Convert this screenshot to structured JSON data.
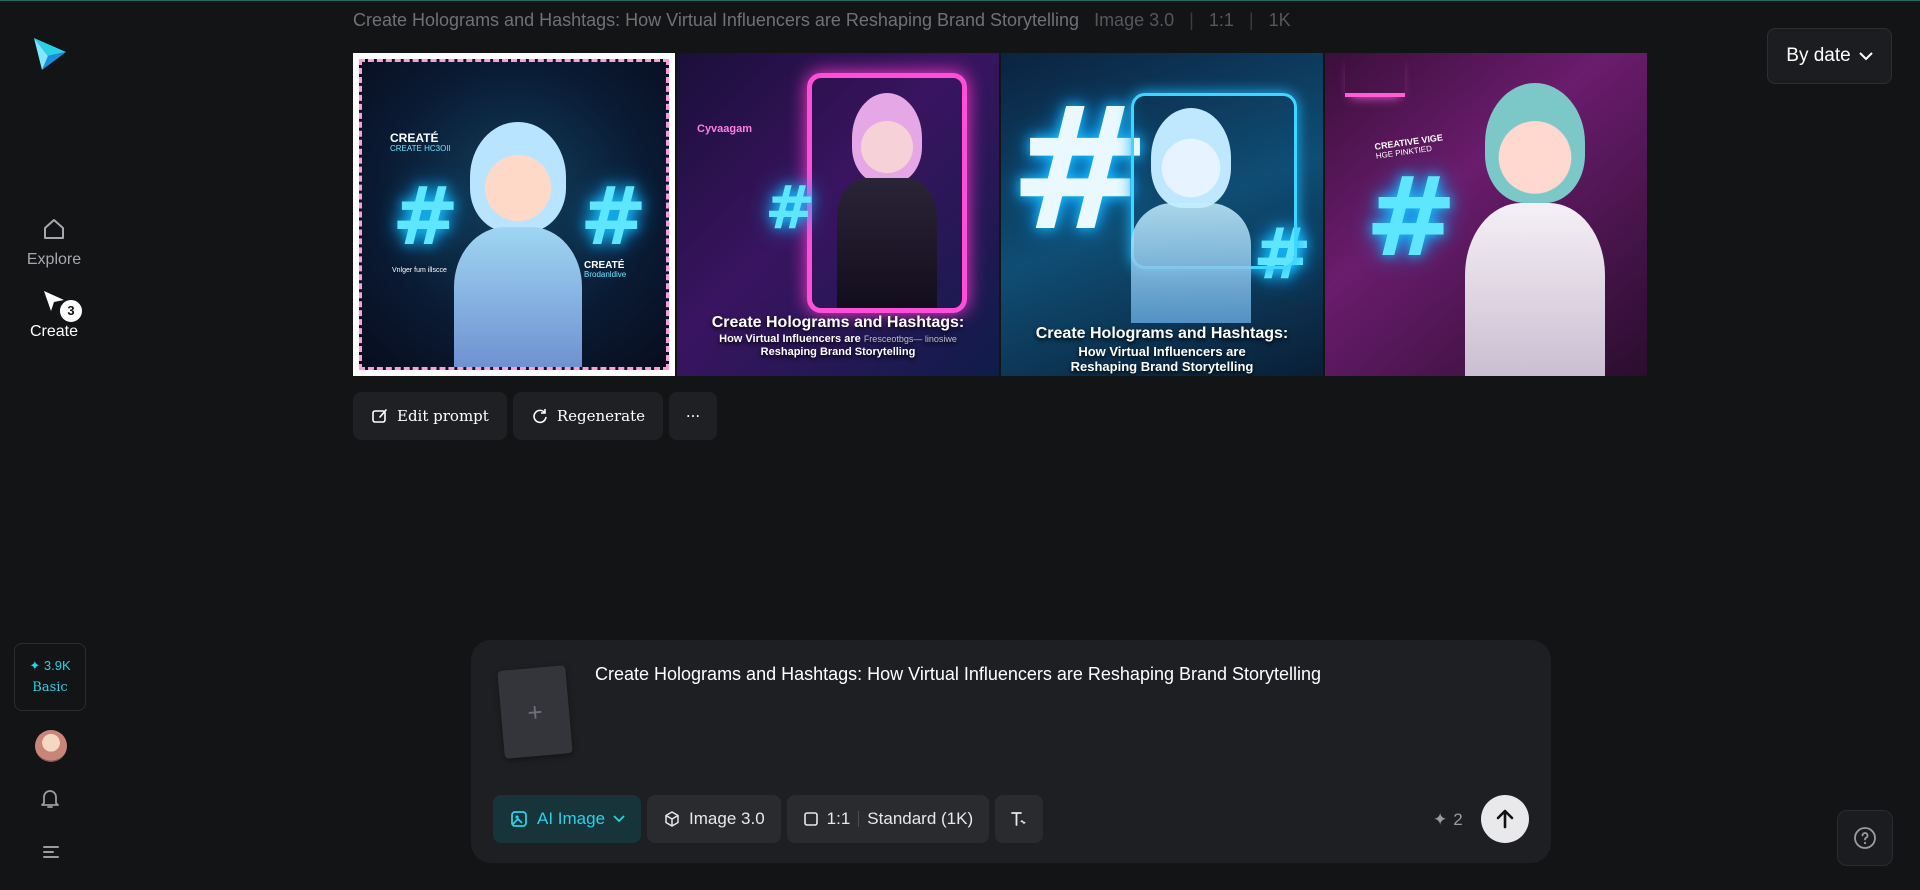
{
  "header": {
    "prompt_title": "Create Holograms and Hashtags: How Virtual Influencers are Reshaping Brand Storytelling",
    "model": "Image 3.0",
    "ratio": "1:1",
    "resolution": "1K",
    "sort_label": "By date"
  },
  "sidebar": {
    "explore_label": "Explore",
    "create_label": "Create",
    "create_badge": "3",
    "credits_amount": "3.9K",
    "plan": "Basic"
  },
  "images": [
    {
      "top_text": "CREATÉ",
      "top_sub": "CREATE HC3OII",
      "bottom_left": "Vnlger fum illscce",
      "bottom_right": "CREATÉ",
      "bottom_right_sub": "Brodanldive"
    },
    {
      "panel_text": "Cyvaagam",
      "caption_title": "Create Holograms and Hashtags:",
      "caption_line1": "How Virtual Influencers are",
      "caption_extra": "Fresceotbgs— linosiwe",
      "caption_line2": "Reshaping Brand Storytelling"
    },
    {
      "caption_title": "Create Holograms and Hashtags:",
      "caption_line1": "How Virtual Influencers are",
      "caption_line2": "Reshaping Brand Storytelling"
    },
    {
      "sign_text": "CREATIVE VIGE",
      "sign_sub": "HGE PINKTIED"
    }
  ],
  "actions": {
    "edit_prompt": "Edit prompt",
    "regenerate": "Regenerate",
    "more": "···"
  },
  "composer": {
    "prompt": "Create Holograms and Hashtags: How Virtual Influencers are Reshaping Brand Storytelling",
    "upload_symbol": "+",
    "mode": "AI Image",
    "model": "Image 3.0",
    "ratio": "1:1",
    "quality": "Standard (1K)",
    "cost": "2"
  },
  "colors": {
    "accent": "#2ad1e6",
    "background": "#131416",
    "panel": "#1e1f22"
  }
}
